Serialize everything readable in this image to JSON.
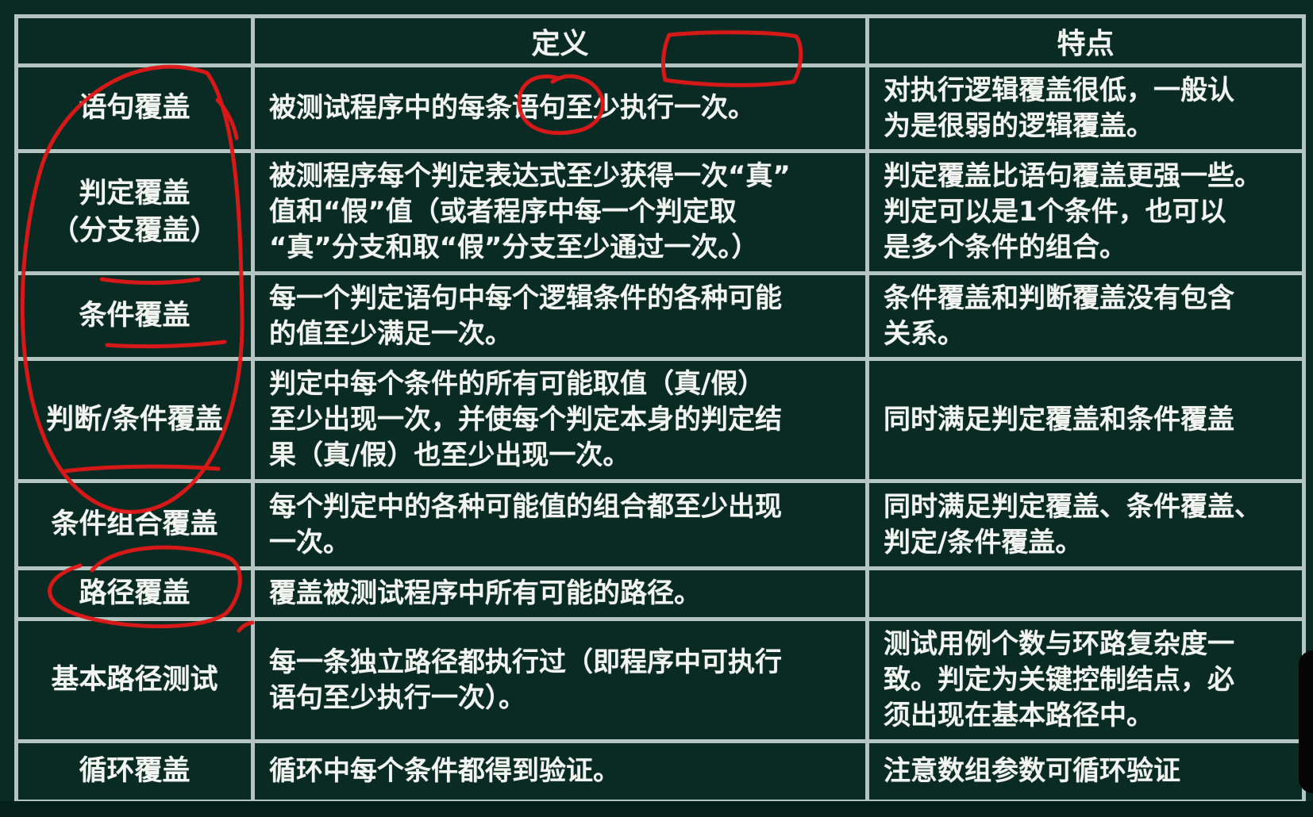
{
  "table": {
    "headers": [
      "",
      "定义",
      "特点"
    ],
    "rows": [
      {
        "name": [
          "语句覆盖"
        ],
        "definition": [
          "被测试程序中的每条语句至少执行一次。"
        ],
        "feature": [
          "对执行逻辑覆盖很低，一般认",
          "为是很弱的逻辑覆盖。"
        ]
      },
      {
        "name": [
          "判定覆盖",
          "（分支覆盖）"
        ],
        "definition": [
          "被测程序每个判定表达式至少获得一次“真”",
          "值和“假”值（或者程序中每一个判定取",
          "“真”分支和取“假”分支至少通过一次。）"
        ],
        "feature": [
          "判定覆盖比语句覆盖更强一些。",
          "判定可以是1个条件，也可以",
          "是多个条件的组合。"
        ]
      },
      {
        "name": [
          "条件覆盖"
        ],
        "definition": [
          "每一个判定语句中每个逻辑条件的各种可能",
          "的值至少满足一次。"
        ],
        "feature": [
          "条件覆盖和判断覆盖没有包含",
          "关系。"
        ]
      },
      {
        "name": [
          "判断/条件覆盖"
        ],
        "definition": [
          "判定中每个条件的所有可能取值（真/假）",
          "至少出现一次，并使每个判定本身的判定结",
          "果（真/假）也至少出现一次。"
        ],
        "feature": [
          "同时满足判定覆盖和条件覆盖"
        ]
      },
      {
        "name": [
          "条件组合覆盖"
        ],
        "definition": [
          "每个判定中的各种可能值的组合都至少出现",
          "一次。"
        ],
        "feature": [
          "同时满足判定覆盖、条件覆盖、",
          "判定/条件覆盖。"
        ]
      },
      {
        "name": [
          "路径覆盖"
        ],
        "definition": [
          "覆盖被测试程序中所有可能的路径。"
        ],
        "feature": []
      },
      {
        "name": [
          "基本路径测试"
        ],
        "definition": [
          "每一条独立路径都执行过（即程序中可执行",
          "语句至少执行一次）。"
        ],
        "feature": [
          "测试用例个数与环路复杂度一",
          "致。判定为关键控制结点，必",
          "须出现在基本路径中。"
        ]
      },
      {
        "name": [
          "循环覆盖"
        ],
        "definition": [
          "循环中每个条件都得到验证。"
        ],
        "feature": [
          "注意数组参数可循环验证"
        ]
      }
    ]
  },
  "colors": {
    "background": "#0a2b23",
    "grid": "#b4c5c1",
    "text": "#f2f4f1",
    "annotation": "#e01818"
  }
}
